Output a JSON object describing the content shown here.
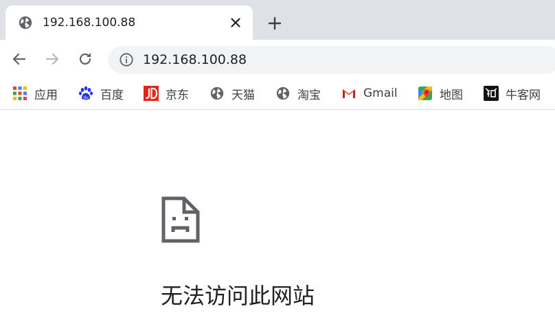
{
  "tab": {
    "title": "192.168.100.88",
    "favicon": "globe-icon"
  },
  "toolbar": {
    "back": "arrow-left-icon",
    "forward": "arrow-right-icon",
    "reload": "reload-icon",
    "url": "192.168.100.88"
  },
  "bookmarks": [
    {
      "label": "应用",
      "icon": "apps-grid-icon"
    },
    {
      "label": "百度",
      "icon": "baidu-paw-icon"
    },
    {
      "label": "京东",
      "icon": "jd-logo-icon"
    },
    {
      "label": "天猫",
      "icon": "globe-icon"
    },
    {
      "label": "淘宝",
      "icon": "globe-icon"
    },
    {
      "label": "Gmail",
      "icon": "gmail-icon"
    },
    {
      "label": "地图",
      "icon": "maps-icon"
    },
    {
      "label": "牛客网",
      "icon": "nowcoder-icon"
    }
  ],
  "error": {
    "title": "无法访问此网站",
    "icon": "sad-page-icon"
  },
  "colors": {
    "tabstrip": "#dee1e6",
    "omnibox": "#f1f3f4",
    "icon_gray": "#5f6368",
    "text": "#202124",
    "disabled": "#9aa0a6"
  }
}
